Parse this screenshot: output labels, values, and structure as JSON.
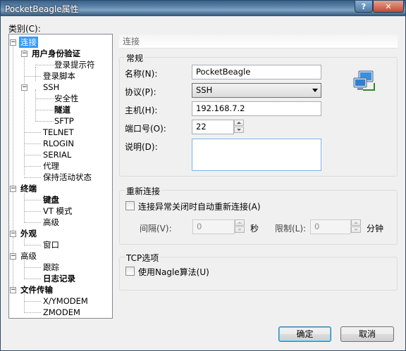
{
  "window": {
    "title": "PocketBeagle属性",
    "help": "?",
    "close": "✕"
  },
  "category_label": "类别(C):",
  "tree": {
    "n0": "连接",
    "n1": "用户身份验证",
    "n2": "登录提示符",
    "n3": "登录脚本",
    "n4": "SSH",
    "n5": "安全性",
    "n6": "隧道",
    "n7": "SFTP",
    "n8": "TELNET",
    "n9": "RLOGIN",
    "n10": "SERIAL",
    "n11": "代理",
    "n12": "保持活动状态",
    "n13": "终端",
    "n14": "键盘",
    "n15": "VT 模式",
    "n16": "高级",
    "n17": "外观",
    "n18": "窗口",
    "n19": "高级",
    "n20": "跟踪",
    "n21": "日志记录",
    "n22": "文件传输",
    "n23": "X/YMODEM",
    "n24": "ZMODEM"
  },
  "panel": {
    "header": "连接",
    "general": {
      "title": "常规",
      "name_label": "名称(N):",
      "name_value": "PocketBeagle",
      "protocol_label": "协议(P):",
      "protocol_value": "SSH",
      "host_label": "主机(H):",
      "host_value": "192.168.7.2",
      "port_label": "端口号(O):",
      "port_value": "22",
      "desc_label": "说明(D):",
      "desc_value": ""
    },
    "reconnect": {
      "title": "重新连接",
      "checkbox_label": "连接异常关闭时自动重新连接(A)",
      "interval_label": "间隔(V):",
      "interval_value": "0",
      "interval_unit": "秒",
      "limit_label": "限制(L):",
      "limit_value": "0",
      "limit_unit": "分钟"
    },
    "tcp": {
      "title": "TCP选项",
      "nagle_label": "使用Nagle算法(U)"
    }
  },
  "buttons": {
    "ok": "确定",
    "cancel": "取消"
  }
}
